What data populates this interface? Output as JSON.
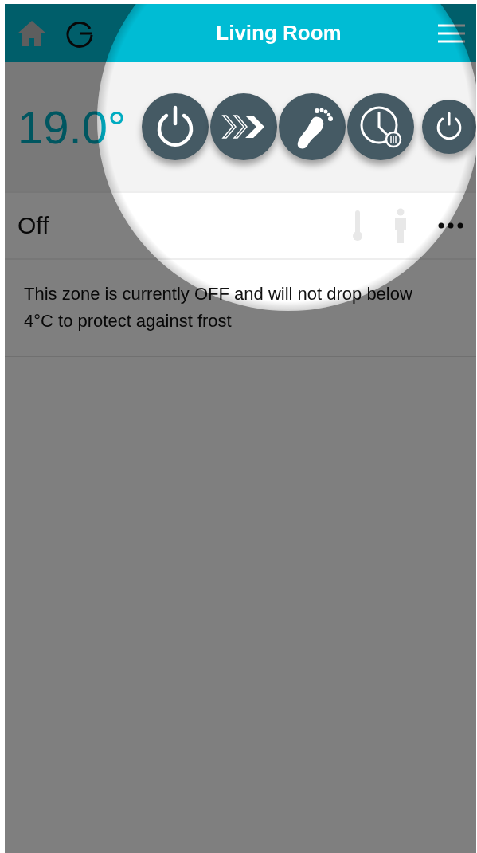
{
  "header": {
    "title": "Living Room"
  },
  "temperature": "19.0°",
  "status": {
    "label": "Off"
  },
  "description": "This zone is currently OFF and will not drop below 4°C to protect against frost"
}
